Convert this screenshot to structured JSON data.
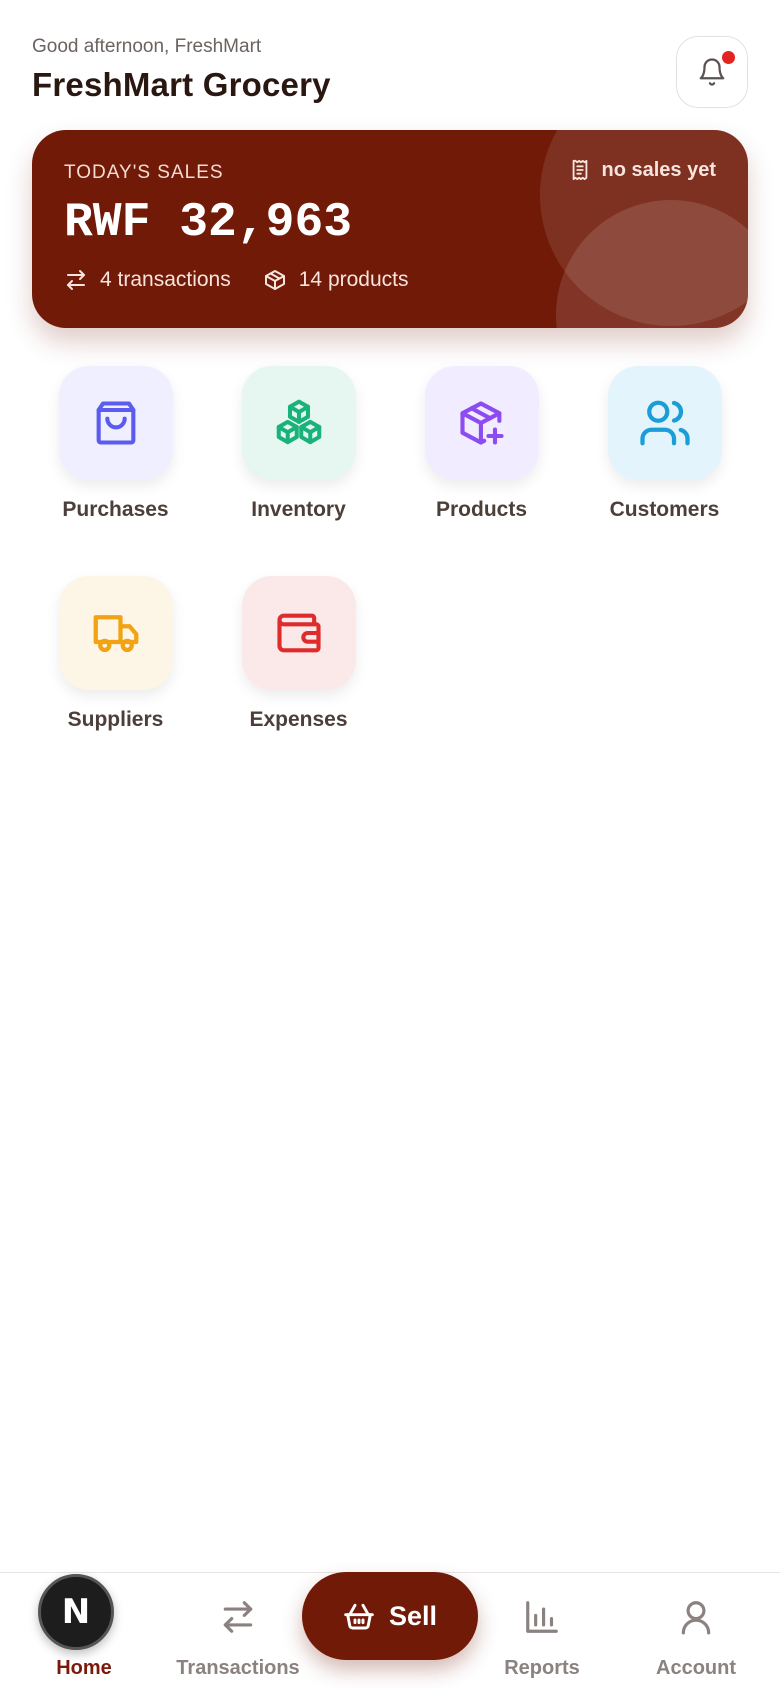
{
  "header": {
    "greeting": "Good afternoon, FreshMart",
    "store_name": "FreshMart Grocery",
    "bell_icon": "bell-icon"
  },
  "sales_card": {
    "label": "TODAY'S SALES",
    "amount": "RWF 32,963",
    "status": "no sales yet",
    "transactions": "4 transactions",
    "products": "14 products",
    "color": "#711a08"
  },
  "quick_actions": [
    {
      "label": "Purchases",
      "icon": "shopping-bag-icon",
      "bg": "#efefff",
      "color": "#5b5bf0"
    },
    {
      "label": "Inventory",
      "icon": "boxes-icon",
      "bg": "#e6f6f0",
      "color": "#19b27b"
    },
    {
      "label": "Products",
      "icon": "package-plus-icon",
      "bg": "#f1ecff",
      "color": "#8c4cf0"
    },
    {
      "label": "Customers",
      "icon": "users-icon",
      "bg": "#e3f4fc",
      "color": "#1b9ed8"
    },
    {
      "label": "Suppliers",
      "icon": "truck-icon",
      "bg": "#fdf5e6",
      "color": "#f2a313"
    },
    {
      "label": "Expenses",
      "icon": "wallet-icon",
      "bg": "#fbe8e8",
      "color": "#de2b2b"
    }
  ],
  "bottom_nav": {
    "home": "Home",
    "transactions": "Transactions",
    "sell": "Sell",
    "reports": "Reports",
    "account": "Account",
    "avatar_letter": "N",
    "active": "Home"
  }
}
